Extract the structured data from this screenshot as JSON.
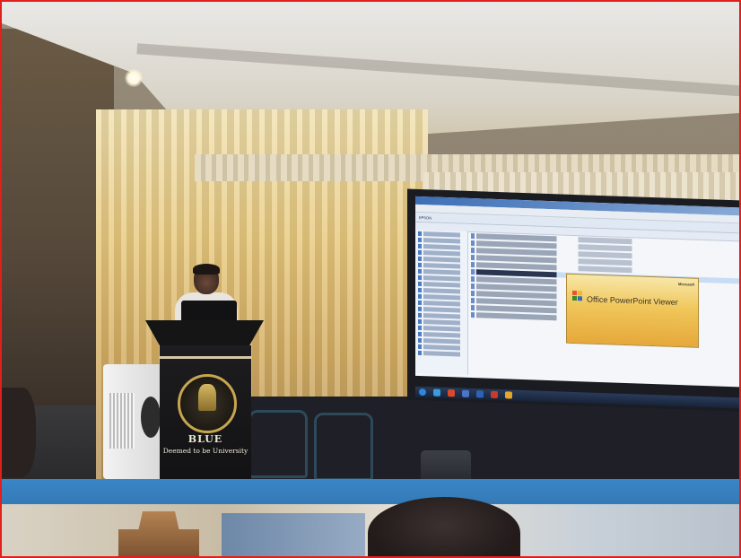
{
  "scene": {
    "border_color": "#e0201c",
    "accent_stage": "#3a86c6"
  },
  "podium": {
    "name": "BLUE",
    "tagline": "Deemed to be University"
  },
  "projected_screen": {
    "window": {
      "address_text": "EPSON",
      "selected_file": "Dynamic models for implementable..."
    },
    "splash": {
      "brand": "Microsoft",
      "title": "Office PowerPoint Viewer",
      "logo_colors": [
        "#e8542c",
        "#f7b52c",
        "#3c8a2e",
        "#2c6fc0"
      ]
    }
  },
  "icons": {
    "emblem": "university-emblem-icon",
    "ppt_logo": "office-logo-icon"
  }
}
